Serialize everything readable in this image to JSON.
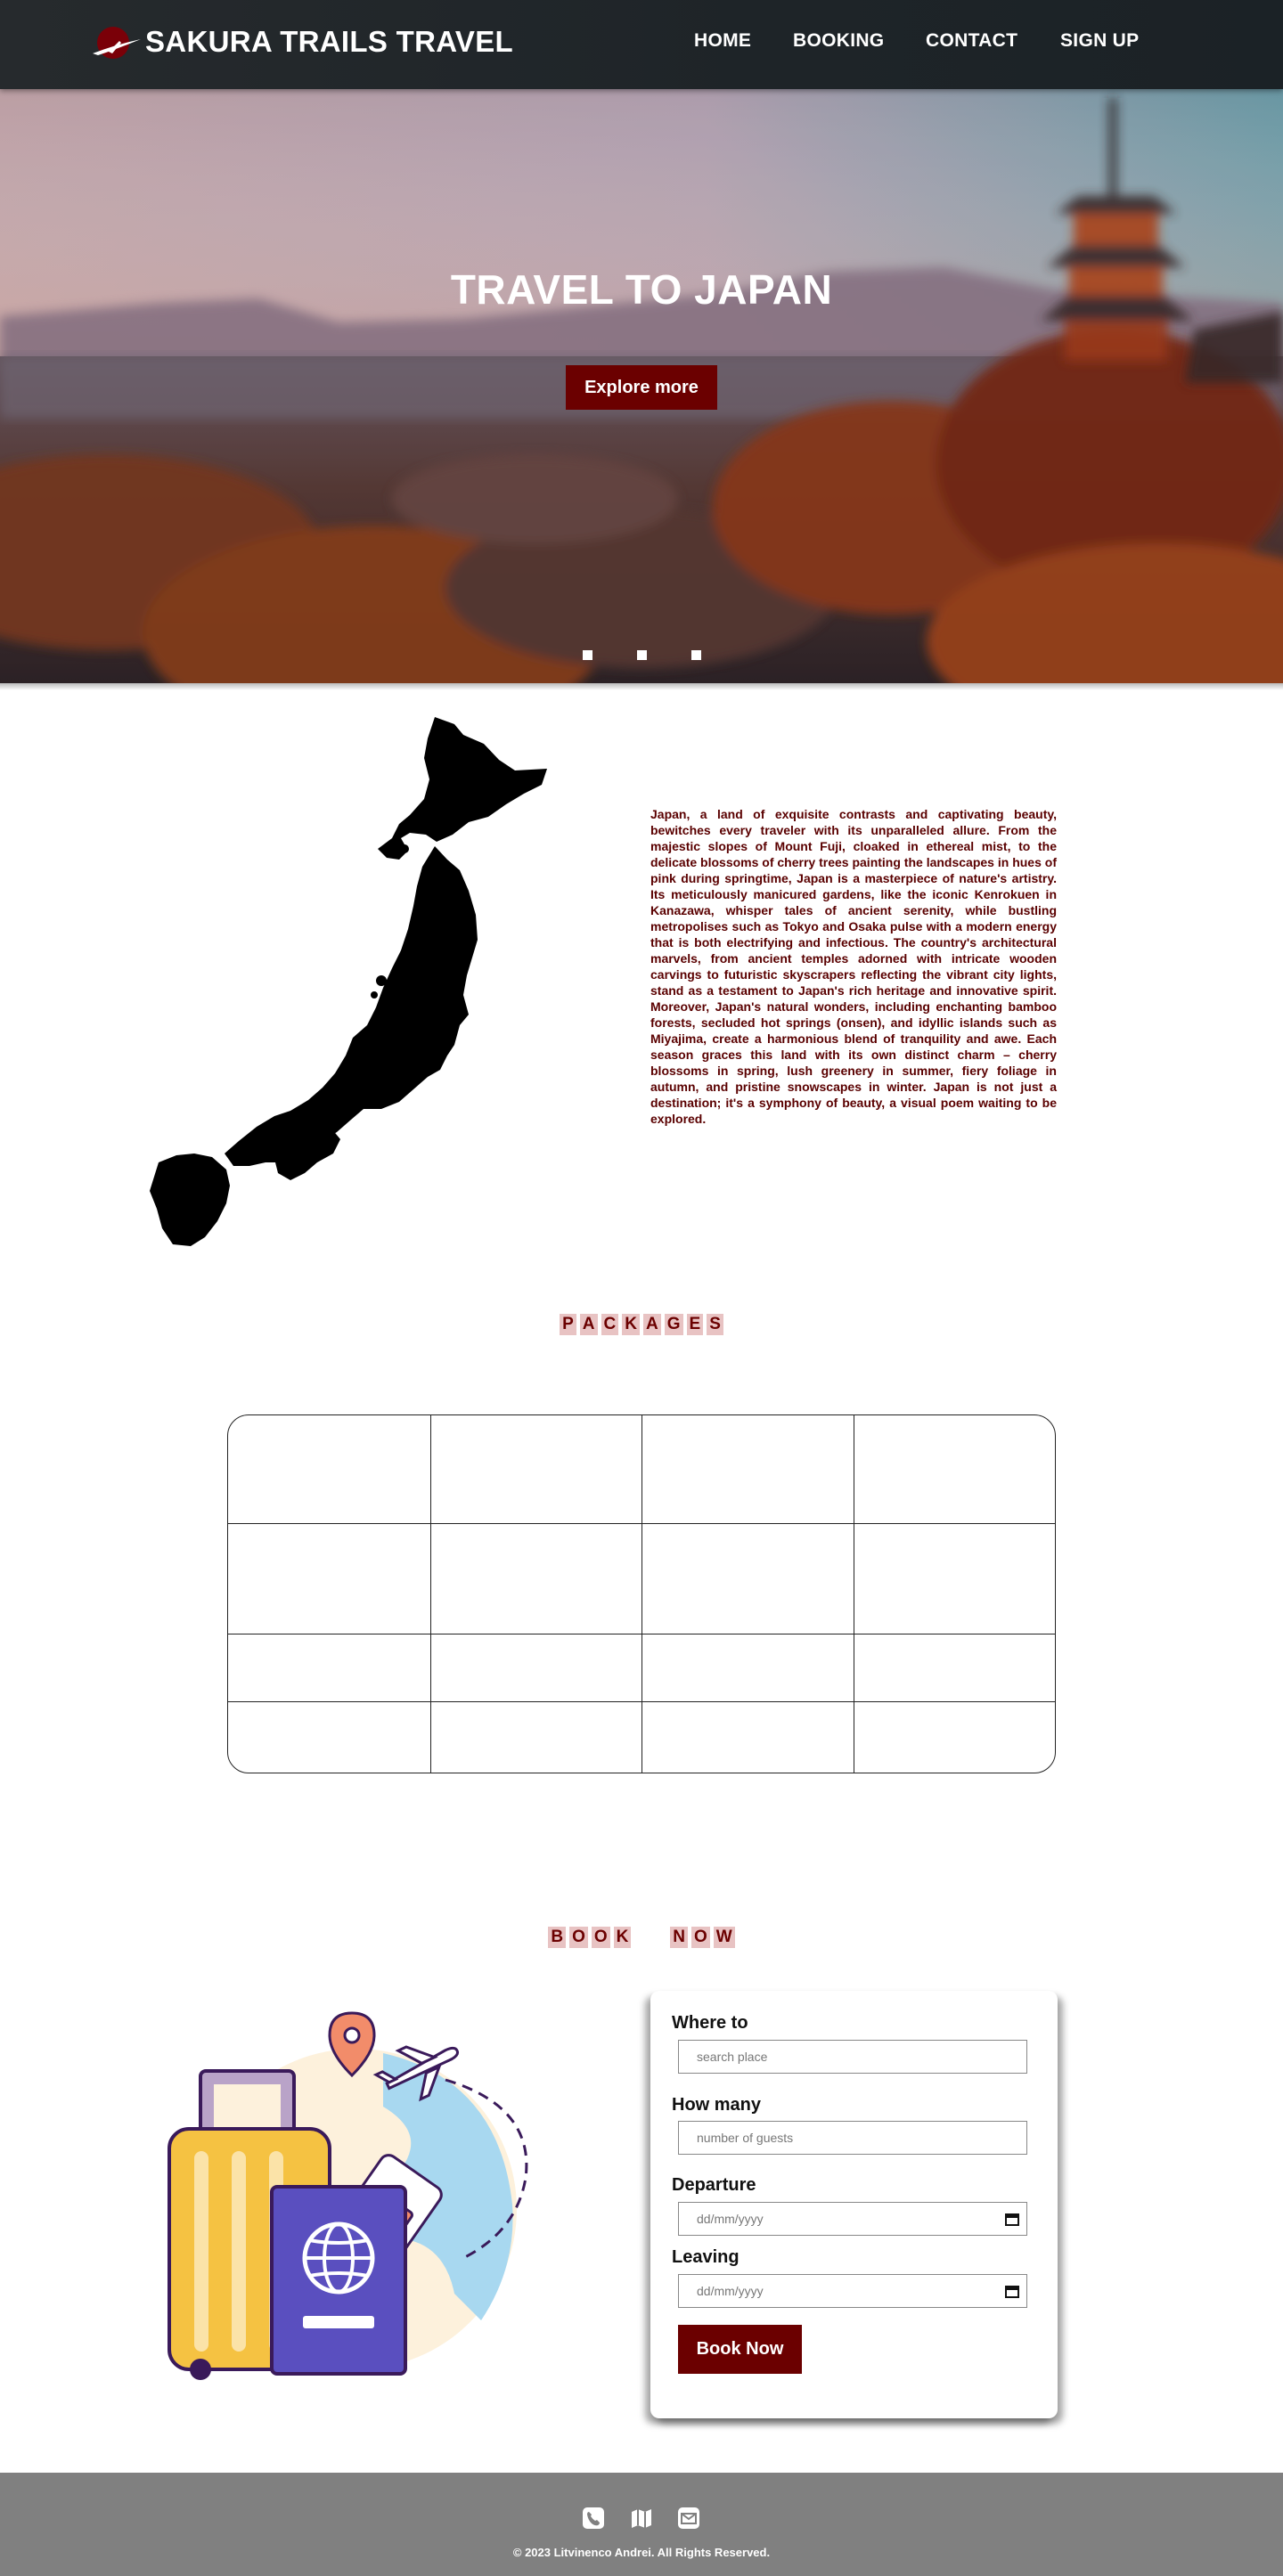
{
  "header": {
    "brand": "SAKURA TRAILS TRAVEL",
    "nav": [
      "HOME",
      "BOOKING",
      "CONTACT",
      "SIGN UP"
    ]
  },
  "hero": {
    "title": "TRAVEL TO JAPAN",
    "cta_label": "Explore more",
    "slide_count": 3
  },
  "intro": {
    "text": "Japan, a land of exquisite contrasts and captivating beauty, bewitches every traveler with its unparalleled allure. From the majestic slopes of Mount Fuji, cloaked in ethereal mist, to the delicate blossoms of cherry trees painting the landscapes in hues of pink during springtime, Japan is a masterpiece of nature's artistry. Its meticulously manicured gardens, like the iconic Kenrokuen in Kanazawa, whisper tales of ancient serenity, while bustling metropolises such as Tokyo and Osaka pulse with a modern energy that is both electrifying and infectious. The country's architectural marvels, from ancient temples adorned with intricate wooden carvings to futuristic skyscrapers reflecting the vibrant city lights, stand as a testament to Japan's rich heritage and innovative spirit. Moreover, Japan's natural wonders, including enchanting bamboo forests, secluded hot springs (onsen), and idyllic islands such as Miyajima, create a harmonious blend of tranquility and awe. Each season graces this land with its own distinct charm – cherry blossoms in spring, lush greenery in summer, fiery foliage in autumn, and pristine snowscapes in winter. Japan is not just a destination; it's a symphony of beauty, a visual poem waiting to be explored."
  },
  "packages": {
    "title_letters": [
      "P",
      "A",
      "C",
      "K",
      "A",
      "G",
      "E",
      "S"
    ]
  },
  "booking": {
    "title_words": [
      [
        "B",
        "O",
        "O",
        "K"
      ],
      [
        "N",
        "O",
        "W"
      ]
    ],
    "where_label": "Where to",
    "where_placeholder": "search place",
    "guests_label": "How many",
    "guests_placeholder": "number of guests",
    "departure_label": "Departure",
    "departure_placeholder": "dd/mm/yyyy",
    "leaving_label": "Leaving",
    "leaving_placeholder": "dd/mm/yyyy",
    "submit_label": "Book Now"
  },
  "footer": {
    "icons": [
      "phone-icon",
      "map-icon",
      "mail-icon"
    ],
    "copyright": "© 2023 Litvinenco Andrei. All Rights Reserved."
  },
  "colors": {
    "accent": "#6b0000",
    "header_bg": "#1e2428",
    "footer_bg": "#808080",
    "title_chip": "#e8c3c3"
  }
}
